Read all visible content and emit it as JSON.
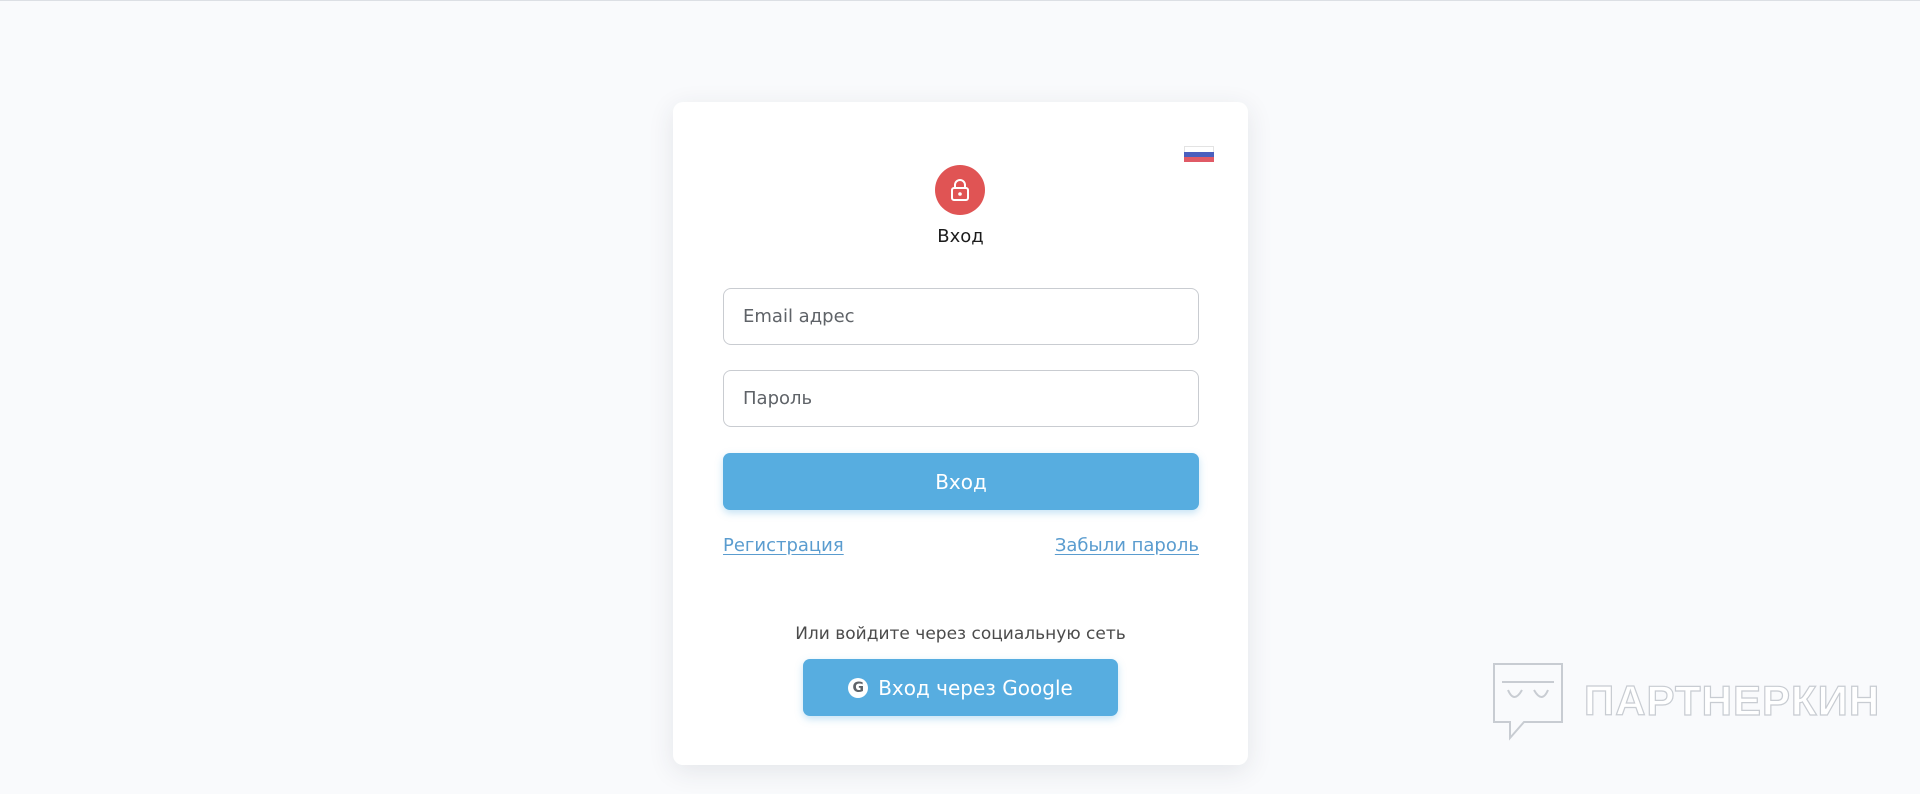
{
  "lang_flag": {
    "icon": "russia-flag-icon",
    "colors": [
      "#ffffff",
      "#4a5fbe",
      "#e05a66"
    ]
  },
  "login": {
    "lock_icon": "lock-icon",
    "lock_color": "#e05454",
    "title": "Вход",
    "email_placeholder": "Email адрес",
    "password_placeholder": "Пароль",
    "submit_label": "Вход",
    "register_link": "Регистрация",
    "forgot_link": "Забыли пароль",
    "social_text": "Или войдите через социальную сеть",
    "google_icon": "google-icon",
    "google_glyph": "G",
    "google_label": "Вход через Google",
    "accent_color": "#57ade0",
    "link_color": "#5a9ccf"
  },
  "watermark": {
    "icon": "partnerkin-logo-icon",
    "text": "ПАРТНЕРКИН"
  }
}
